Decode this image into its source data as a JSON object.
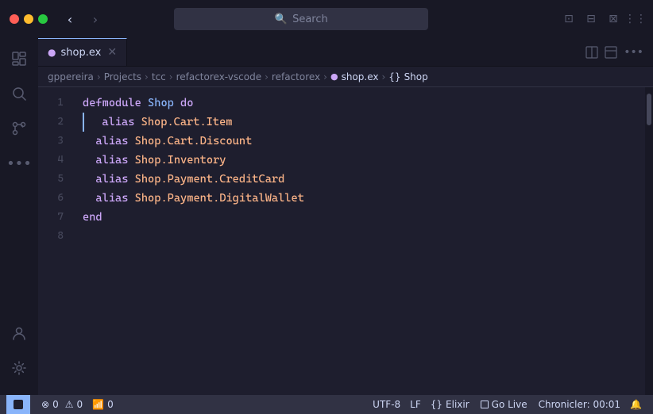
{
  "titlebar": {
    "search_placeholder": "Search",
    "nav_back": "‹",
    "nav_forward": "›",
    "layout_icons": [
      "⊞",
      "⊟",
      "⊠",
      "⋮⋮"
    ]
  },
  "tabs": [
    {
      "icon": "●",
      "label": "shop.ex",
      "close": "✕",
      "active": true
    }
  ],
  "tab_right_icons": [
    "⎘",
    "⊠",
    "…"
  ],
  "breadcrumb": {
    "parts": [
      "gppereira",
      "Projects",
      "tcc",
      "refactorex-vscode",
      "refactorex",
      "shop.ex",
      "Shop"
    ],
    "separators": [
      ">",
      ">",
      ">",
      ">",
      ">",
      ">"
    ],
    "file_icon": "●",
    "module_icon": "{}"
  },
  "code": {
    "lines": [
      {
        "num": 1,
        "tokens": [
          {
            "text": "defmodule ",
            "class": "kw"
          },
          {
            "text": "Shop",
            "class": "fn"
          },
          {
            "text": " do",
            "class": "kw-do"
          }
        ]
      },
      {
        "num": 2,
        "tokens": [
          {
            "text": "  alias ",
            "class": "alias-kw"
          },
          {
            "text": "Shop.Cart.Item",
            "class": "module-path"
          }
        ],
        "active": true
      },
      {
        "num": 3,
        "tokens": [
          {
            "text": "  alias ",
            "class": "alias-kw"
          },
          {
            "text": "Shop.Cart.Discount",
            "class": "module-path"
          }
        ]
      },
      {
        "num": 4,
        "tokens": [
          {
            "text": "  alias ",
            "class": "alias-kw"
          },
          {
            "text": "Shop.Inventory",
            "class": "module-path"
          }
        ]
      },
      {
        "num": 5,
        "tokens": [
          {
            "text": "  alias ",
            "class": "alias-kw"
          },
          {
            "text": "Shop.Payment.CreditCard",
            "class": "module-path"
          }
        ]
      },
      {
        "num": 6,
        "tokens": [
          {
            "text": "  alias ",
            "class": "alias-kw"
          },
          {
            "text": "Shop.Payment.DigitalWallet",
            "class": "module-path"
          }
        ]
      },
      {
        "num": 7,
        "tokens": [
          {
            "text": "end",
            "class": "end-kw"
          }
        ]
      },
      {
        "num": 8,
        "tokens": []
      }
    ]
  },
  "activity": {
    "top_items": [
      {
        "name": "explorer-icon",
        "icon": "⧉",
        "active": false
      },
      {
        "name": "search-icon",
        "icon": "⌕",
        "active": false
      },
      {
        "name": "git-icon",
        "icon": "⎇",
        "active": false
      },
      {
        "name": "more-icon",
        "icon": "…",
        "active": false
      }
    ],
    "bottom_items": [
      {
        "name": "account-icon",
        "icon": "👤",
        "active": false
      },
      {
        "name": "settings-icon",
        "icon": "⚙",
        "active": false
      }
    ]
  },
  "status_bar": {
    "left_icon": "⊞",
    "errors": "0",
    "warnings": "0",
    "info": "0",
    "encoding": "UTF-8",
    "line_ending": "LF",
    "language": "Elixir",
    "go_live": "Go Live",
    "chronicler": "Chronicler: 00:01",
    "bell_icon": "🔔"
  }
}
